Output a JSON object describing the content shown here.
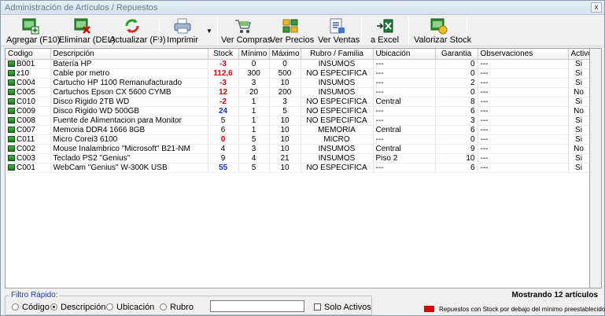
{
  "window": {
    "title": "Administración de Artículos / Repuestos",
    "close_label": "x"
  },
  "toolbar": {
    "buttons": [
      {
        "label": "Agregar (F10)",
        "icon": "add-sheet-icon"
      },
      {
        "label": "Eliminar (DEL)",
        "icon": "delete-sheet-icon"
      },
      {
        "label": "Actualizar (F9)",
        "icon": "refresh-icon"
      },
      {
        "label": "Imprimir",
        "icon": "printer-icon"
      },
      {
        "label": "Ver Compras",
        "icon": "cart-icon"
      },
      {
        "label": "Ver Precios",
        "icon": "price-tags-icon"
      },
      {
        "label": "Ver Ventas",
        "icon": "sales-icon"
      },
      {
        "label": "a Excel",
        "icon": "excel-icon"
      },
      {
        "label": "Valorizar Stock",
        "icon": "valuation-icon"
      }
    ],
    "dropdown_arrow": "▼"
  },
  "table": {
    "columns": [
      "Codigo",
      "Descripción",
      "Stock",
      "Mínimo",
      "Máximo",
      "Rubro / Familia",
      "Ubicación",
      "Garantia",
      "Observaciones",
      "Activo"
    ],
    "rows": [
      {
        "codigo": "B001",
        "descripcion": "Batería HP",
        "stock": "-3",
        "stock_style": "red",
        "minimo": "0",
        "maximo": "0",
        "rubro": "INSUMOS",
        "ubicacion": "---",
        "garantia": "0",
        "observaciones": "---",
        "activo": "Si"
      },
      {
        "codigo": "z10",
        "descripcion": "Cable por metro",
        "stock": "112,6",
        "stock_style": "red",
        "minimo": "300",
        "maximo": "500",
        "rubro": "NO ESPECIFICA",
        "ubicacion": "---",
        "garantia": "0",
        "observaciones": "---",
        "activo": "Si"
      },
      {
        "codigo": "C004",
        "descripcion": "Cartucho HP 1100 Remanufacturado",
        "stock": "-3",
        "stock_style": "red",
        "minimo": "3",
        "maximo": "10",
        "rubro": "INSUMOS",
        "ubicacion": "---",
        "garantia": "2",
        "observaciones": "---",
        "activo": "Si"
      },
      {
        "codigo": "C005",
        "descripcion": "Cartuchos Epson CX 5600 CYMB",
        "stock": "12",
        "stock_style": "red",
        "minimo": "20",
        "maximo": "200",
        "rubro": "INSUMOS",
        "ubicacion": "---",
        "garantia": "0",
        "observaciones": "---",
        "activo": "No"
      },
      {
        "codigo": "C010",
        "descripcion": "Disco Rigido 2TB WD",
        "stock": "-2",
        "stock_style": "red",
        "minimo": "1",
        "maximo": "3",
        "rubro": "NO ESPECIFICA",
        "ubicacion": "Central",
        "garantia": "8",
        "observaciones": "---",
        "activo": "Si"
      },
      {
        "codigo": "C009",
        "descripcion": "Disco Rigido WD 500GB",
        "stock": "24",
        "stock_style": "blue",
        "minimo": "1",
        "maximo": "5",
        "rubro": "NO ESPECIFICA",
        "ubicacion": "---",
        "garantia": "6",
        "observaciones": "---",
        "activo": "No"
      },
      {
        "codigo": "C008",
        "descripcion": "Fuente de Alimentacion para Monitor",
        "stock": "5",
        "stock_style": "norm",
        "minimo": "1",
        "maximo": "10",
        "rubro": "NO ESPECIFICA",
        "ubicacion": "---",
        "garantia": "3",
        "observaciones": "---",
        "activo": "Si"
      },
      {
        "codigo": "C007",
        "descripcion": "Memoria DDR4 1666 8GB",
        "stock": "6",
        "stock_style": "norm",
        "minimo": "1",
        "maximo": "10",
        "rubro": "MEMORIA",
        "ubicacion": "Central",
        "garantia": "6",
        "observaciones": "---",
        "activo": "Si"
      },
      {
        "codigo": "C011",
        "descripcion": "Micro Corei3 6100",
        "stock": "0",
        "stock_style": "red",
        "minimo": "5",
        "maximo": "10",
        "rubro": "MICRO",
        "ubicacion": "---",
        "garantia": "0",
        "observaciones": "---",
        "activo": "Si"
      },
      {
        "codigo": "C002",
        "descripcion": "Mouse Inalambrico \"Microsoft\" B21-NM",
        "stock": "4",
        "stock_style": "norm",
        "minimo": "3",
        "maximo": "10",
        "rubro": "INSUMOS",
        "ubicacion": "Central",
        "garantia": "9",
        "observaciones": "---",
        "activo": "No"
      },
      {
        "codigo": "C003",
        "descripcion": "Teclado PS2 \"Genius\"",
        "stock": "9",
        "stock_style": "norm",
        "minimo": "4",
        "maximo": "21",
        "rubro": "INSUMOS",
        "ubicacion": "Piso 2",
        "garantia": "10",
        "observaciones": "---",
        "activo": "Si"
      },
      {
        "codigo": "C001",
        "descripcion": "WebCam \"Genius\" W-300K USB",
        "stock": "55",
        "stock_style": "blue",
        "minimo": "5",
        "maximo": "10",
        "rubro": "NO ESPECIFICA",
        "ubicacion": "---",
        "garantia": "6",
        "observaciones": "---",
        "activo": "Si"
      }
    ]
  },
  "status": {
    "showing": "Mostrando 12 artículos"
  },
  "filter": {
    "legend": "Filtro Rápido:",
    "options": [
      {
        "label": "Código",
        "selected": false
      },
      {
        "label": "Descripción",
        "selected": true
      },
      {
        "label": "Ubicación",
        "selected": false
      },
      {
        "label": "Rubro",
        "selected": false
      }
    ],
    "input_value": "",
    "solo_activos_label": "Solo Activos",
    "solo_activos_checked": false
  },
  "legend_note": {
    "text": "Repuestos con Stock por debajo del mínimo preestablecido",
    "color": "#e00000"
  }
}
